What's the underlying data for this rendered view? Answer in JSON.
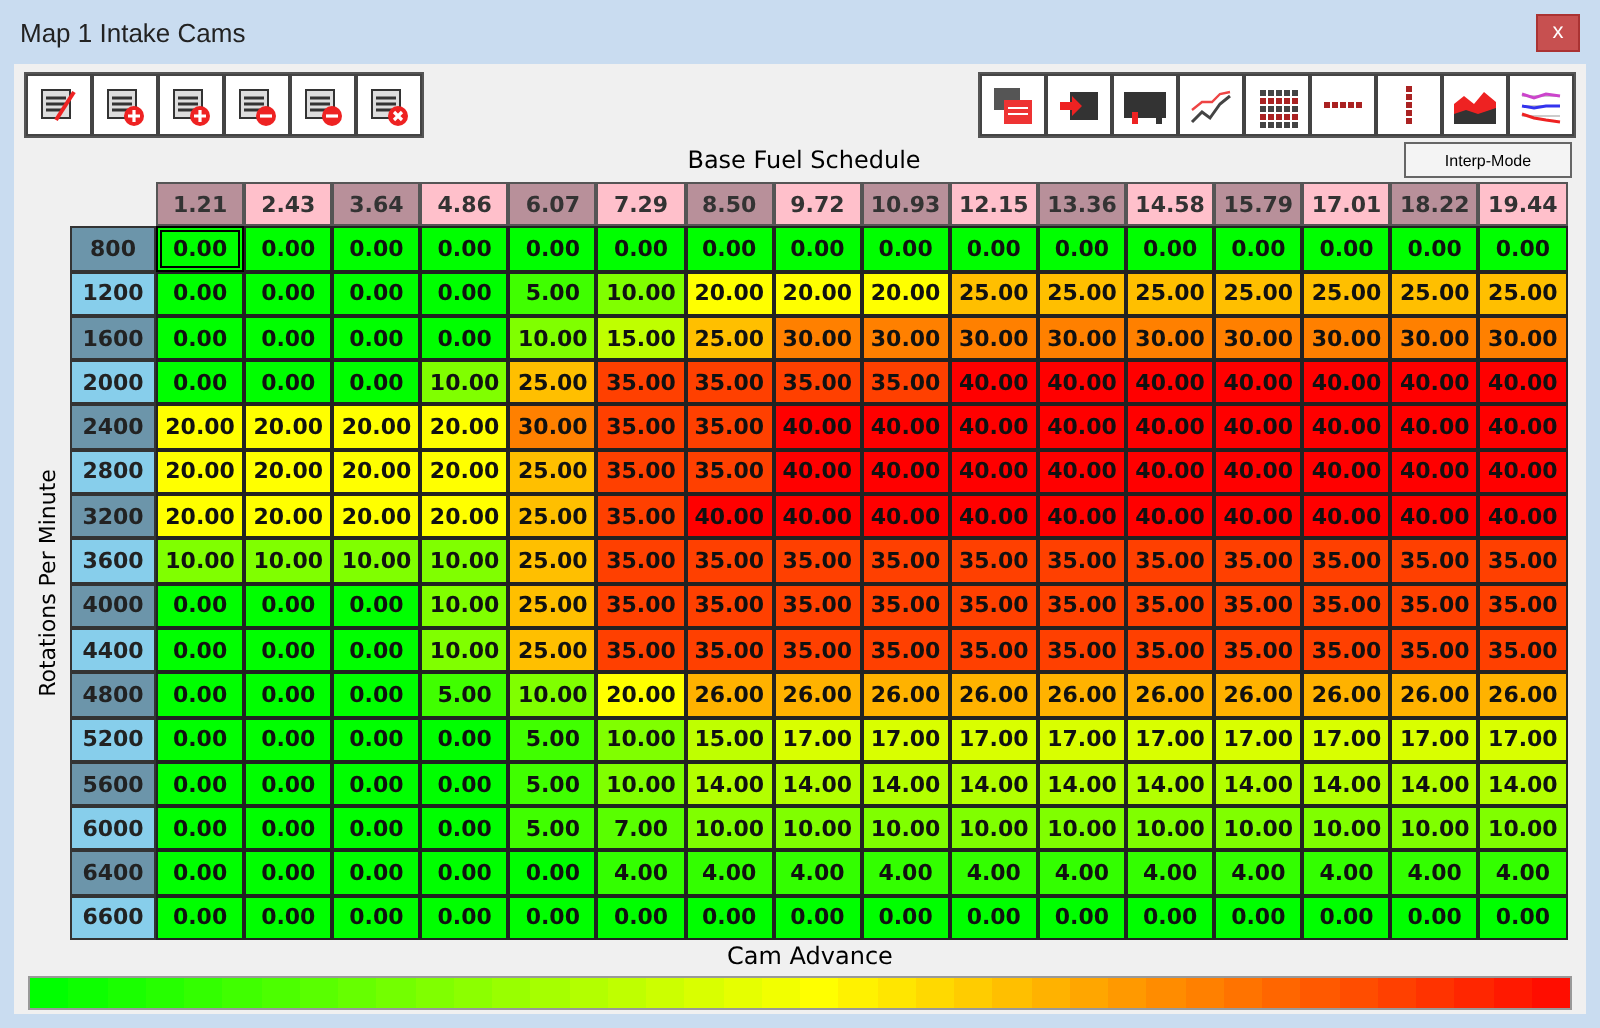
{
  "window": {
    "title": "Map 1 Intake Cams",
    "close": "x"
  },
  "table_title": "Base Fuel Schedule",
  "interp_button": "Interp-Mode",
  "y_axis_label": "Rotations Per Minute",
  "x_axis_label": "Cam Advance",
  "columns": [
    "1.21",
    "2.43",
    "3.64",
    "4.86",
    "6.07",
    "7.29",
    "8.50",
    "9.72",
    "10.93",
    "12.15",
    "13.36",
    "14.58",
    "15.79",
    "17.01",
    "18.22",
    "19.44"
  ],
  "rows": [
    {
      "rpm": "800",
      "cells": [
        {
          "value": "0.00",
          "selected": true
        },
        {
          "value": "0.00",
          "selected": false
        },
        {
          "value": "0.00",
          "selected": false
        },
        {
          "value": "0.00",
          "selected": false
        },
        {
          "value": "0.00",
          "selected": false
        },
        {
          "value": "0.00",
          "selected": false
        },
        {
          "value": "0.00",
          "selected": false
        },
        {
          "value": "0.00",
          "selected": false
        },
        {
          "value": "0.00",
          "selected": false
        },
        {
          "value": "0.00",
          "selected": false
        },
        {
          "value": "0.00",
          "selected": false
        },
        {
          "value": "0.00",
          "selected": false
        },
        {
          "value": "0.00",
          "selected": false
        },
        {
          "value": "0.00",
          "selected": false
        },
        {
          "value": "0.00",
          "selected": false
        },
        {
          "value": "0.00",
          "selected": false
        }
      ]
    },
    {
      "rpm": "1200",
      "cells": [
        {
          "value": "0.00",
          "selected": false
        },
        {
          "value": "0.00",
          "selected": false
        },
        {
          "value": "0.00",
          "selected": false
        },
        {
          "value": "0.00",
          "selected": false
        },
        {
          "value": "5.00",
          "selected": false
        },
        {
          "value": "10.00",
          "selected": false
        },
        {
          "value": "20.00",
          "selected": false
        },
        {
          "value": "20.00",
          "selected": false
        },
        {
          "value": "20.00",
          "selected": false
        },
        {
          "value": "25.00",
          "selected": false
        },
        {
          "value": "25.00",
          "selected": false
        },
        {
          "value": "25.00",
          "selected": false
        },
        {
          "value": "25.00",
          "selected": false
        },
        {
          "value": "25.00",
          "selected": false
        },
        {
          "value": "25.00",
          "selected": false
        },
        {
          "value": "25.00",
          "selected": false
        }
      ]
    },
    {
      "rpm": "1600",
      "cells": [
        {
          "value": "0.00",
          "selected": false
        },
        {
          "value": "0.00",
          "selected": false
        },
        {
          "value": "0.00",
          "selected": false
        },
        {
          "value": "0.00",
          "selected": false
        },
        {
          "value": "10.00",
          "selected": false
        },
        {
          "value": "15.00",
          "selected": false
        },
        {
          "value": "25.00",
          "selected": false
        },
        {
          "value": "30.00",
          "selected": false
        },
        {
          "value": "30.00",
          "selected": false
        },
        {
          "value": "30.00",
          "selected": false
        },
        {
          "value": "30.00",
          "selected": false
        },
        {
          "value": "30.00",
          "selected": false
        },
        {
          "value": "30.00",
          "selected": false
        },
        {
          "value": "30.00",
          "selected": false
        },
        {
          "value": "30.00",
          "selected": false
        },
        {
          "value": "30.00",
          "selected": false
        }
      ]
    },
    {
      "rpm": "2000",
      "cells": [
        {
          "value": "0.00",
          "selected": false
        },
        {
          "value": "0.00",
          "selected": false
        },
        {
          "value": "0.00",
          "selected": false
        },
        {
          "value": "10.00",
          "selected": false
        },
        {
          "value": "25.00",
          "selected": false
        },
        {
          "value": "35.00",
          "selected": false
        },
        {
          "value": "35.00",
          "selected": false
        },
        {
          "value": "35.00",
          "selected": false
        },
        {
          "value": "35.00",
          "selected": false
        },
        {
          "value": "40.00",
          "selected": false
        },
        {
          "value": "40.00",
          "selected": false
        },
        {
          "value": "40.00",
          "selected": false
        },
        {
          "value": "40.00",
          "selected": false
        },
        {
          "value": "40.00",
          "selected": false
        },
        {
          "value": "40.00",
          "selected": false
        },
        {
          "value": "40.00",
          "selected": false
        }
      ]
    },
    {
      "rpm": "2400",
      "cells": [
        {
          "value": "20.00",
          "selected": false
        },
        {
          "value": "20.00",
          "selected": false
        },
        {
          "value": "20.00",
          "selected": false
        },
        {
          "value": "20.00",
          "selected": false
        },
        {
          "value": "30.00",
          "selected": false
        },
        {
          "value": "35.00",
          "selected": false
        },
        {
          "value": "35.00",
          "selected": false
        },
        {
          "value": "40.00",
          "selected": false
        },
        {
          "value": "40.00",
          "selected": false
        },
        {
          "value": "40.00",
          "selected": false
        },
        {
          "value": "40.00",
          "selected": false
        },
        {
          "value": "40.00",
          "selected": false
        },
        {
          "value": "40.00",
          "selected": false
        },
        {
          "value": "40.00",
          "selected": false
        },
        {
          "value": "40.00",
          "selected": false
        },
        {
          "value": "40.00",
          "selected": false
        }
      ]
    },
    {
      "rpm": "2800",
      "cells": [
        {
          "value": "20.00",
          "selected": false
        },
        {
          "value": "20.00",
          "selected": false
        },
        {
          "value": "20.00",
          "selected": false
        },
        {
          "value": "20.00",
          "selected": false
        },
        {
          "value": "25.00",
          "selected": false
        },
        {
          "value": "35.00",
          "selected": false
        },
        {
          "value": "35.00",
          "selected": false
        },
        {
          "value": "40.00",
          "selected": false
        },
        {
          "value": "40.00",
          "selected": false
        },
        {
          "value": "40.00",
          "selected": false
        },
        {
          "value": "40.00",
          "selected": false
        },
        {
          "value": "40.00",
          "selected": false
        },
        {
          "value": "40.00",
          "selected": false
        },
        {
          "value": "40.00",
          "selected": false
        },
        {
          "value": "40.00",
          "selected": false
        },
        {
          "value": "40.00",
          "selected": false
        }
      ]
    },
    {
      "rpm": "3200",
      "cells": [
        {
          "value": "20.00",
          "selected": false
        },
        {
          "value": "20.00",
          "selected": false
        },
        {
          "value": "20.00",
          "selected": false
        },
        {
          "value": "20.00",
          "selected": false
        },
        {
          "value": "25.00",
          "selected": false
        },
        {
          "value": "35.00",
          "selected": false
        },
        {
          "value": "40.00",
          "selected": false
        },
        {
          "value": "40.00",
          "selected": false
        },
        {
          "value": "40.00",
          "selected": false
        },
        {
          "value": "40.00",
          "selected": false
        },
        {
          "value": "40.00",
          "selected": false
        },
        {
          "value": "40.00",
          "selected": false
        },
        {
          "value": "40.00",
          "selected": false
        },
        {
          "value": "40.00",
          "selected": false
        },
        {
          "value": "40.00",
          "selected": false
        },
        {
          "value": "40.00",
          "selected": false
        }
      ]
    },
    {
      "rpm": "3600",
      "cells": [
        {
          "value": "10.00",
          "selected": false
        },
        {
          "value": "10.00",
          "selected": false
        },
        {
          "value": "10.00",
          "selected": false
        },
        {
          "value": "10.00",
          "selected": false
        },
        {
          "value": "25.00",
          "selected": false
        },
        {
          "value": "35.00",
          "selected": false
        },
        {
          "value": "35.00",
          "selected": false
        },
        {
          "value": "35.00",
          "selected": false
        },
        {
          "value": "35.00",
          "selected": false
        },
        {
          "value": "35.00",
          "selected": false
        },
        {
          "value": "35.00",
          "selected": false
        },
        {
          "value": "35.00",
          "selected": false
        },
        {
          "value": "35.00",
          "selected": false
        },
        {
          "value": "35.00",
          "selected": false
        },
        {
          "value": "35.00",
          "selected": false
        },
        {
          "value": "35.00",
          "selected": false
        }
      ]
    },
    {
      "rpm": "4000",
      "cells": [
        {
          "value": "0.00",
          "selected": false
        },
        {
          "value": "0.00",
          "selected": false
        },
        {
          "value": "0.00",
          "selected": false
        },
        {
          "value": "10.00",
          "selected": false
        },
        {
          "value": "25.00",
          "selected": false
        },
        {
          "value": "35.00",
          "selected": false
        },
        {
          "value": "35.00",
          "selected": false
        },
        {
          "value": "35.00",
          "selected": false
        },
        {
          "value": "35.00",
          "selected": false
        },
        {
          "value": "35.00",
          "selected": false
        },
        {
          "value": "35.00",
          "selected": false
        },
        {
          "value": "35.00",
          "selected": false
        },
        {
          "value": "35.00",
          "selected": false
        },
        {
          "value": "35.00",
          "selected": false
        },
        {
          "value": "35.00",
          "selected": false
        },
        {
          "value": "35.00",
          "selected": false
        }
      ]
    },
    {
      "rpm": "4400",
      "cells": [
        {
          "value": "0.00",
          "selected": false
        },
        {
          "value": "0.00",
          "selected": false
        },
        {
          "value": "0.00",
          "selected": false
        },
        {
          "value": "10.00",
          "selected": false
        },
        {
          "value": "25.00",
          "selected": false
        },
        {
          "value": "35.00",
          "selected": false
        },
        {
          "value": "35.00",
          "selected": false
        },
        {
          "value": "35.00",
          "selected": false
        },
        {
          "value": "35.00",
          "selected": false
        },
        {
          "value": "35.00",
          "selected": false
        },
        {
          "value": "35.00",
          "selected": false
        },
        {
          "value": "35.00",
          "selected": false
        },
        {
          "value": "35.00",
          "selected": false
        },
        {
          "value": "35.00",
          "selected": false
        },
        {
          "value": "35.00",
          "selected": false
        },
        {
          "value": "35.00",
          "selected": false
        }
      ]
    },
    {
      "rpm": "4800",
      "cells": [
        {
          "value": "0.00",
          "selected": false
        },
        {
          "value": "0.00",
          "selected": false
        },
        {
          "value": "0.00",
          "selected": false
        },
        {
          "value": "5.00",
          "selected": false
        },
        {
          "value": "10.00",
          "selected": false
        },
        {
          "value": "20.00",
          "selected": false
        },
        {
          "value": "26.00",
          "selected": false
        },
        {
          "value": "26.00",
          "selected": false
        },
        {
          "value": "26.00",
          "selected": false
        },
        {
          "value": "26.00",
          "selected": false
        },
        {
          "value": "26.00",
          "selected": false
        },
        {
          "value": "26.00",
          "selected": false
        },
        {
          "value": "26.00",
          "selected": false
        },
        {
          "value": "26.00",
          "selected": false
        },
        {
          "value": "26.00",
          "selected": false
        },
        {
          "value": "26.00",
          "selected": false
        }
      ]
    },
    {
      "rpm": "5200",
      "cells": [
        {
          "value": "0.00",
          "selected": false
        },
        {
          "value": "0.00",
          "selected": false
        },
        {
          "value": "0.00",
          "selected": false
        },
        {
          "value": "0.00",
          "selected": false
        },
        {
          "value": "5.00",
          "selected": false
        },
        {
          "value": "10.00",
          "selected": false
        },
        {
          "value": "15.00",
          "selected": false
        },
        {
          "value": "17.00",
          "selected": false
        },
        {
          "value": "17.00",
          "selected": false
        },
        {
          "value": "17.00",
          "selected": false
        },
        {
          "value": "17.00",
          "selected": false
        },
        {
          "value": "17.00",
          "selected": false
        },
        {
          "value": "17.00",
          "selected": false
        },
        {
          "value": "17.00",
          "selected": false
        },
        {
          "value": "17.00",
          "selected": false
        },
        {
          "value": "17.00",
          "selected": false
        }
      ]
    },
    {
      "rpm": "5600",
      "cells": [
        {
          "value": "0.00",
          "selected": false
        },
        {
          "value": "0.00",
          "selected": false
        },
        {
          "value": "0.00",
          "selected": false
        },
        {
          "value": "0.00",
          "selected": false
        },
        {
          "value": "5.00",
          "selected": false
        },
        {
          "value": "10.00",
          "selected": false
        },
        {
          "value": "14.00",
          "selected": false
        },
        {
          "value": "14.00",
          "selected": false
        },
        {
          "value": "14.00",
          "selected": false
        },
        {
          "value": "14.00",
          "selected": false
        },
        {
          "value": "14.00",
          "selected": false
        },
        {
          "value": "14.00",
          "selected": false
        },
        {
          "value": "14.00",
          "selected": false
        },
        {
          "value": "14.00",
          "selected": false
        },
        {
          "value": "14.00",
          "selected": false
        },
        {
          "value": "14.00",
          "selected": false
        }
      ]
    },
    {
      "rpm": "6000",
      "cells": [
        {
          "value": "0.00",
          "selected": false
        },
        {
          "value": "0.00",
          "selected": false
        },
        {
          "value": "0.00",
          "selected": false
        },
        {
          "value": "0.00",
          "selected": false
        },
        {
          "value": "5.00",
          "selected": false
        },
        {
          "value": "7.00",
          "selected": false
        },
        {
          "value": "10.00",
          "selected": false
        },
        {
          "value": "10.00",
          "selected": false
        },
        {
          "value": "10.00",
          "selected": false
        },
        {
          "value": "10.00",
          "selected": false
        },
        {
          "value": "10.00",
          "selected": false
        },
        {
          "value": "10.00",
          "selected": false
        },
        {
          "value": "10.00",
          "selected": false
        },
        {
          "value": "10.00",
          "selected": false
        },
        {
          "value": "10.00",
          "selected": false
        },
        {
          "value": "10.00",
          "selected": false
        }
      ]
    },
    {
      "rpm": "6400",
      "cells": [
        {
          "value": "0.00",
          "selected": false
        },
        {
          "value": "0.00",
          "selected": false
        },
        {
          "value": "0.00",
          "selected": false
        },
        {
          "value": "0.00",
          "selected": false
        },
        {
          "value": "0.00",
          "selected": false
        },
        {
          "value": "4.00",
          "selected": false
        },
        {
          "value": "4.00",
          "selected": false
        },
        {
          "value": "4.00",
          "selected": false
        },
        {
          "value": "4.00",
          "selected": false
        },
        {
          "value": "4.00",
          "selected": false
        },
        {
          "value": "4.00",
          "selected": false
        },
        {
          "value": "4.00",
          "selected": false
        },
        {
          "value": "4.00",
          "selected": false
        },
        {
          "value": "4.00",
          "selected": false
        },
        {
          "value": "4.00",
          "selected": false
        },
        {
          "value": "4.00",
          "selected": false
        }
      ]
    },
    {
      "rpm": "6600",
      "cells": [
        {
          "value": "0.00",
          "selected": false
        },
        {
          "value": "0.00",
          "selected": false
        },
        {
          "value": "0.00",
          "selected": false
        },
        {
          "value": "0.00",
          "selected": false
        },
        {
          "value": "0.00",
          "selected": false
        },
        {
          "value": "0.00",
          "selected": false
        },
        {
          "value": "0.00",
          "selected": false
        },
        {
          "value": "0.00",
          "selected": false
        },
        {
          "value": "0.00",
          "selected": false
        },
        {
          "value": "0.00",
          "selected": false
        },
        {
          "value": "0.00",
          "selected": false
        },
        {
          "value": "0.00",
          "selected": false
        },
        {
          "value": "0.00",
          "selected": false
        },
        {
          "value": "0.00",
          "selected": false
        },
        {
          "value": "0.00",
          "selected": false
        },
        {
          "value": "0.00",
          "selected": false
        }
      ]
    }
  ]
}
